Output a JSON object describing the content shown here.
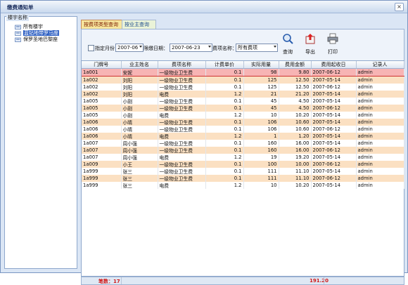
{
  "window": {
    "title": "缴费通知单",
    "close": "×"
  },
  "tree": {
    "title": "楼宇名称",
    "items": [
      {
        "label": "所有楼宇",
        "selected": false
      },
      {
        "label": "蓝钻地带罗马座",
        "selected": true
      },
      {
        "label": "保罗圣地巴黎座",
        "selected": false
      }
    ]
  },
  "tabs": [
    "按费项类型查询",
    "按业主查询"
  ],
  "filters": {
    "month_label": "指定月份",
    "month_value": "2007-06",
    "date_label": "限缴日期：",
    "date_value": "2007-06-23",
    "fee_label": "费项名称：",
    "fee_value": "所有费项"
  },
  "buttons": {
    "query": "查询",
    "export": "导出",
    "print": "打印"
  },
  "grid": {
    "columns": [
      "门牌号",
      "业主姓名",
      "费项名称",
      "计费单价",
      "实际用量",
      "费用金额",
      "费用起收日",
      "记录人"
    ],
    "rows": [
      [
        "1a001",
        "安妮",
        "一级物业卫生费",
        "0.1",
        "98",
        "9.80",
        "2007-06-12",
        "admin"
      ],
      [
        "1a002",
        "刘阳",
        "一级物业卫生费",
        "0.1",
        "125",
        "12.50",
        "2007-05-14",
        "admin"
      ],
      [
        "1a002",
        "刘阳",
        "一级物业卫生费",
        "0.1",
        "125",
        "12.50",
        "2007-06-12",
        "admin"
      ],
      [
        "1a002",
        "刘阳",
        "电费",
        "1.2",
        "21",
        "21.20",
        "2007-05-14",
        "admin"
      ],
      [
        "1a005",
        "小刚",
        "一级物业卫生费",
        "0.1",
        "45",
        "4.50",
        "2007-05-14",
        "admin"
      ],
      [
        "1a005",
        "小刚",
        "一级物业卫生费",
        "0.1",
        "45",
        "4.50",
        "2007-06-12",
        "admin"
      ],
      [
        "1a005",
        "小刚",
        "电费",
        "1.2",
        "10",
        "10.20",
        "2007-05-14",
        "admin"
      ],
      [
        "1a006",
        "小晴",
        "一级物业卫生费",
        "0.1",
        "106",
        "10.60",
        "2007-05-14",
        "admin"
      ],
      [
        "1a006",
        "小晴",
        "一级物业卫生费",
        "0.1",
        "106",
        "10.60",
        "2007-06-12",
        "admin"
      ],
      [
        "1a006",
        "小晴",
        "电费",
        "1.2",
        "1",
        "1.20",
        "2007-05-14",
        "admin"
      ],
      [
        "1a007",
        "周小强",
        "一级物业卫生费",
        "0.1",
        "160",
        "16.00",
        "2007-05-14",
        "admin"
      ],
      [
        "1a007",
        "周小强",
        "一级物业卫生费",
        "0.1",
        "160",
        "16.00",
        "2007-06-12",
        "admin"
      ],
      [
        "1a007",
        "周小强",
        "电费",
        "1.2",
        "19",
        "19.20",
        "2007-05-14",
        "admin"
      ],
      [
        "1a009",
        "小王",
        "一级物业卫生费",
        "0.1",
        "100",
        "10.00",
        "2007-06-12",
        "admin"
      ],
      [
        "1a999",
        "张三",
        "一级物业卫生费",
        "0.1",
        "111",
        "11.10",
        "2007-05-14",
        "admin"
      ],
      [
        "1a999",
        "张三",
        "一级物业卫生费",
        "0.1",
        "111",
        "11.10",
        "2007-06-12",
        "admin"
      ],
      [
        "1a999",
        "张三",
        "电费",
        "1.2",
        "10",
        "10.20",
        "2007-05-14",
        "admin"
      ]
    ]
  },
  "footer": {
    "count": "笔数：17",
    "sum": "191.20"
  },
  "colors": {
    "selected_row": "#f7b4b4",
    "alt_row": "#fbe0c2",
    "total_text": "#d01818",
    "tree_selected": "#2d5fc2"
  }
}
